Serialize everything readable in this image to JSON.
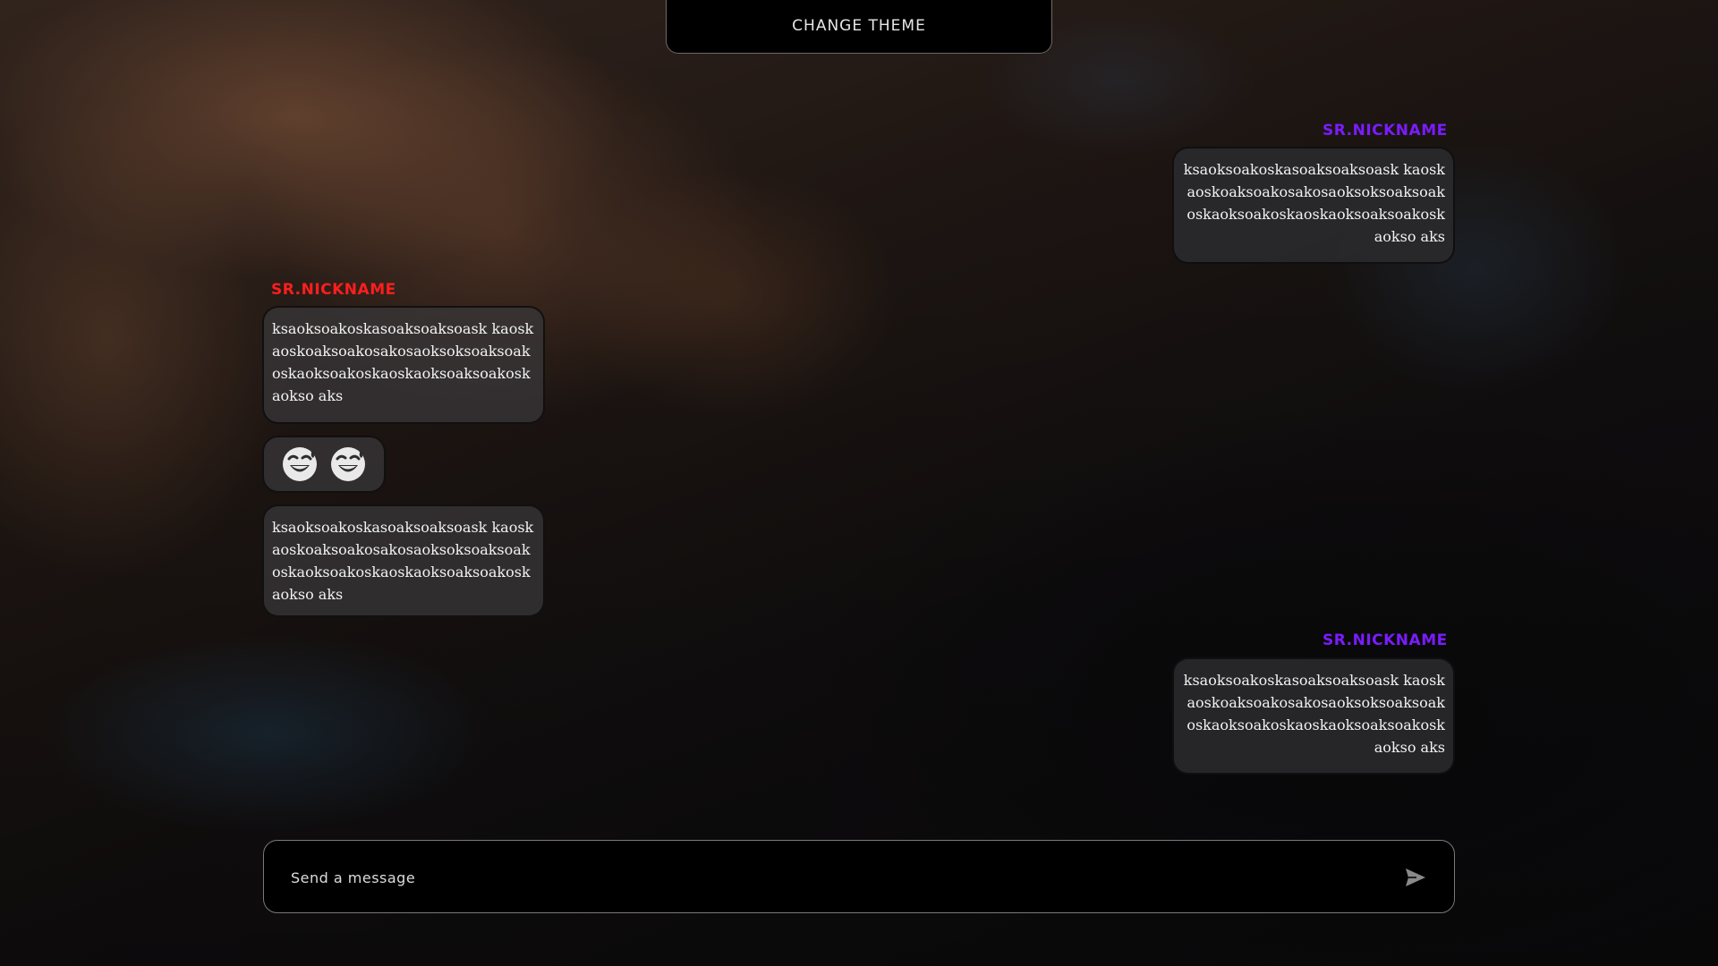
{
  "header": {
    "change_theme_label": "CHANGE THEME"
  },
  "colors": {
    "nick_left": "#ff1e1e",
    "nick_right": "#7a1cff"
  },
  "messages": [
    {
      "side": "right",
      "nickname": "SR.NICKNAME",
      "text": "ksaoksoakoskasoaksoaksoask kaoskaoskoaksoakosakosaoksoksoaksoak oskaoksoakoskaoskaoksoaksoakoskaokso aks"
    },
    {
      "side": "left",
      "nickname": "SR.NICKNAME",
      "text": "ksaoksoakoskasoaksoaksoask kaoskaoskoaksoakosakosaoksoksoaksoak oskaoksoakoskaoskaoksoaksoakoskaokso aks"
    },
    {
      "side": "left",
      "sticker": [
        "grinning-sweat-icon",
        "grinning-sweat-icon"
      ]
    },
    {
      "side": "left",
      "text": "ksaoksoakoskasoaksoaksoask kaoskaoskoaksoakosakosaoksoksoaksoak oskaoksoakoskaoskaoksoaksoakoskaokso aks"
    },
    {
      "side": "right",
      "nickname": "SR.NICKNAME",
      "text": "ksaoksoakoskasoaksoaksoask kaoskaoskoaksoakosakosaoksoksoaksoak oskaoksoakoskaoskaoksoaksoakoskaokso aks"
    }
  ],
  "composer": {
    "placeholder": "Send a message",
    "value": "",
    "send_icon": "send-icon"
  }
}
